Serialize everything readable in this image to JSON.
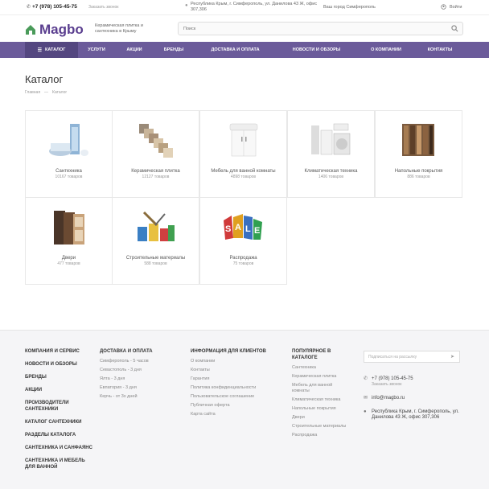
{
  "topbar": {
    "phone": "+7 (978) 105-45-75",
    "callback": "Заказать звонок",
    "address": "Республика Крым, г. Симферополь, ул. Данилова 43 Ж, офис 307,306",
    "city": "Ваш город Симферополь",
    "login": "Войти"
  },
  "header": {
    "logo": "Magbo",
    "tagline": "Керамическая плитка и сантехника в Крыму",
    "search_placeholder": "Поиск"
  },
  "nav": [
    "Каталог",
    "Услуги",
    "Акции",
    "Бренды",
    "Доставка и оплата",
    "Новости и обзоры",
    "О компании",
    "Контакты"
  ],
  "page": {
    "title": "Каталог",
    "breadcrumbs": [
      "Главная",
      "—",
      "Каталог"
    ]
  },
  "catalog": [
    {
      "title": "Сантехника",
      "count": "10167 товаров"
    },
    {
      "title": "Керамическая плитка",
      "count": "12127 товаров"
    },
    {
      "title": "Мебель для ванной комнаты",
      "count": "4898 товаров"
    },
    {
      "title": "Климатическая техника",
      "count": "1406 товаров"
    },
    {
      "title": "Напольные покрытия",
      "count": "886 товаров"
    },
    {
      "title": "Двери",
      "count": "477 товаров"
    },
    {
      "title": "Строительные материалы",
      "count": "588 товаров"
    },
    {
      "title": "Распродажа",
      "count": "75 товаров"
    }
  ],
  "footer": {
    "col1": [
      "Компания и сервис",
      "Новости и обзоры",
      "Бренды",
      "Акции",
      "Производители сантехники",
      "Каталог сантехники",
      "Разделы каталога",
      "Сантехника и санфаянс",
      "Сантехника и мебель для ванной"
    ],
    "col2": {
      "heading": "Доставка и оплата",
      "links": [
        "Симферополь - 5 часов",
        "Севастополь - 3 дня",
        "Ялта - 3 дня",
        "Евпатория - 3 дня",
        "Керчь - от 3х дней"
      ]
    },
    "col3": {
      "heading": "Информация для клиентов",
      "links": [
        "О компании",
        "Контакты",
        "Гарантия",
        "Политика конфиденциальности",
        "Пользовательское соглашение",
        "Публичная оферта",
        "Карта сайта"
      ]
    },
    "col4": {
      "heading": "Популярное в каталоге",
      "links": [
        "Сантехника",
        "Керамическая плитка",
        "Мебель для ванной комнаты",
        "Климатическая техника",
        "Напольные покрытия",
        "Двери",
        "Строительные материалы",
        "Распродажа"
      ]
    },
    "subscribe_placeholder": "Подписаться на рассылку",
    "phone": "+7 (978) 105-45-75",
    "callback": "Заказать звонок",
    "email": "info@magbo.ru",
    "address": "Республика Крым, г. Симферополь, ул. Данилова 43 Ж, офис 307,306"
  },
  "colors": {
    "brand": "#6b5b9a",
    "nav_active": "#544780",
    "logo": "#5a3e8f"
  }
}
